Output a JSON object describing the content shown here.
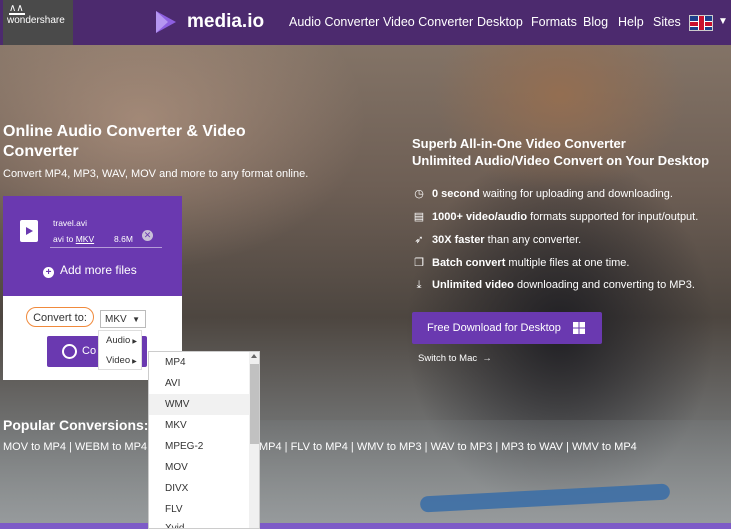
{
  "header": {
    "company": "wondershare",
    "brand": "media.io",
    "nav": [
      "Audio Converter",
      "Video Converter",
      "Desktop",
      "Formats",
      "Blog",
      "Help",
      "Sites"
    ],
    "language_icon": "uk-flag-icon"
  },
  "hero": {
    "title": "Online Audio Converter & Video Converter",
    "subtitle": "Convert MP4, MP3, WAV, MOV and more to any format online."
  },
  "converter": {
    "file_name": "travel.avi",
    "file_to_prefix": "avi to",
    "file_to_format": "MKV",
    "file_size": "8.6M",
    "add_files": "Add more files",
    "convert_to_label": "Convert to:",
    "selected_format": "MKV",
    "convert_button": "Co",
    "categories": [
      "Audio",
      "Video"
    ],
    "formats": [
      "MP4",
      "AVI",
      "WMV",
      "MKV",
      "MPEG-2",
      "MOV",
      "DIVX",
      "FLV",
      "Xvid"
    ]
  },
  "popular": {
    "title": "Popular Conversions:",
    "list_left": "MOV to MP4 | WEBM to MP4",
    "list_right": "MP4 | FLV to MP4 | WMV to MP3 | WAV to MP3 | MP3 to WAV | WMV to MP4"
  },
  "desktop": {
    "title_line1": "Superb All-in-One Video Converter",
    "title_line2": "Unlimited Audio/Video Convert on Your Desktop",
    "features": [
      {
        "icon": "clock-icon",
        "bold": "0 second",
        "rest": " waiting for uploading and downloading."
      },
      {
        "icon": "file-icon",
        "bold": "1000+ video/audio",
        "rest": " formats supported for input/output."
      },
      {
        "icon": "rocket-icon",
        "bold": "30X faster",
        "rest": " than any converter."
      },
      {
        "icon": "copy-icon",
        "bold": "Batch convert",
        "rest": " multiple files at one time."
      },
      {
        "icon": "download-icon",
        "bold": "Unlimited video",
        "rest": " downloading and converting to MP3."
      }
    ],
    "download_button": "Free Download for Desktop",
    "switch_mac": "Switch to Mac"
  },
  "colors": {
    "header_bg": "#4c2a6e",
    "accent": "#6a39b0",
    "highlight_border": "#f08a3c"
  }
}
